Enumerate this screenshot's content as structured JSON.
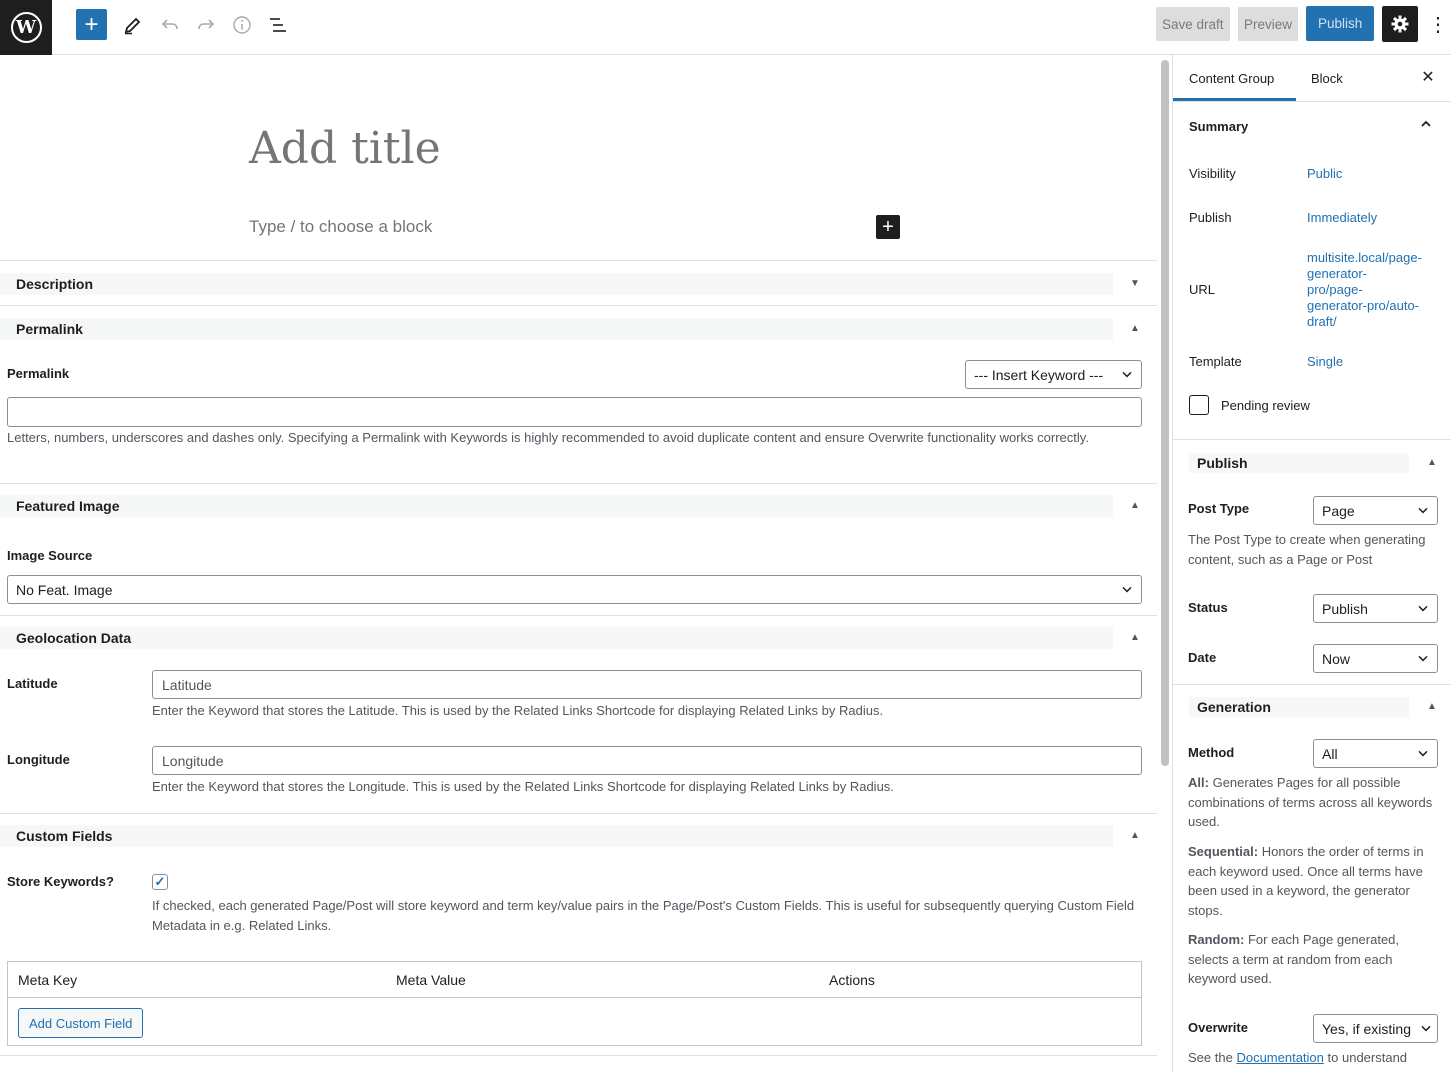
{
  "toolbar": {
    "logo_letter": "W",
    "add_block_symbol": "+",
    "save_draft_label": "Save draft",
    "preview_label": "Preview",
    "publish_label": "Publish",
    "more_symbol": "⋮"
  },
  "editor": {
    "title_placeholder": "Add title",
    "block_placeholder": "Type / to choose a block",
    "inline_add_symbol": "+"
  },
  "meta": {
    "description": {
      "title": "Description"
    },
    "permalink": {
      "title": "Permalink",
      "label": "Permalink",
      "insert_keyword": "--- Insert Keyword ---",
      "value": "",
      "help": "Letters, numbers, underscores and dashes only. Specifying a Permalink with Keywords is highly recommended to avoid duplicate content and ensure Overwrite functionality works correctly."
    },
    "featured_image": {
      "title": "Featured Image",
      "source_label": "Image Source",
      "source_value": "No Feat. Image"
    },
    "geolocation": {
      "title": "Geolocation Data",
      "latitude_label": "Latitude",
      "latitude_placeholder": "Latitude",
      "latitude_help": "Enter the Keyword that stores the Latitude. This is used by the Related Links Shortcode for displaying Related Links by Radius.",
      "longitude_label": "Longitude",
      "longitude_placeholder": "Longitude",
      "longitude_help": "Enter the Keyword that stores the Longitude. This is used by the Related Links Shortcode for displaying Related Links by Radius."
    },
    "custom_fields": {
      "title": "Custom Fields",
      "store_keywords_label": "Store Keywords?",
      "store_keywords_checked": true,
      "store_keywords_help": "If checked, each generated Page/Post will store keyword and term key/value pairs in the Page/Post's Custom Fields. This is useful for subsequently querying Custom Field Metadata in e.g. Related Links.",
      "columns": [
        "Meta Key",
        "Meta Value",
        "Actions"
      ],
      "add_button": "Add Custom Field"
    }
  },
  "sidebar": {
    "tabs": [
      "Content Group",
      "Block"
    ],
    "close_symbol": "✕",
    "summary": {
      "title": "Summary",
      "rows": [
        {
          "label": "Visibility",
          "value": "Public"
        },
        {
          "label": "Publish",
          "value": "Immediately"
        },
        {
          "label": "URL",
          "value": "multisite.local/page-generator-pro/page-generator-pro/auto-draft/"
        },
        {
          "label": "Template",
          "value": "Single"
        }
      ],
      "url_lines": [
        "multisite.local/page-",
        "generator-",
        "pro/page-",
        "generator-pro/auto-",
        "draft/"
      ],
      "pending_review": "Pending review"
    },
    "publish_box": {
      "title": "Publish",
      "post_type_label": "Post Type",
      "post_type_value": "Page",
      "post_type_help": "The Post Type to create when generating content, such as a Page or Post",
      "status_label": "Status",
      "status_value": "Publish",
      "date_label": "Date",
      "date_value": "Now"
    },
    "generation": {
      "title": "Generation",
      "method_label": "Method",
      "method_value": "All",
      "all_term": "All:",
      "all_desc": "Generates Pages for all possible combinations of terms across all keywords used.",
      "sequential_term": "Sequential:",
      "sequential_desc": "Honors the order of terms in each keyword used. Once all terms have been used in a keyword, the generator stops.",
      "random_term": "Random:",
      "random_desc": "For each Page generated, selects a term at random from each keyword used.",
      "overwrite_label": "Overwrite",
      "overwrite_value": "Yes, if existing",
      "see_the": "See the",
      "documentation_link": "Documentation",
      "to_understand": "to understand"
    }
  }
}
